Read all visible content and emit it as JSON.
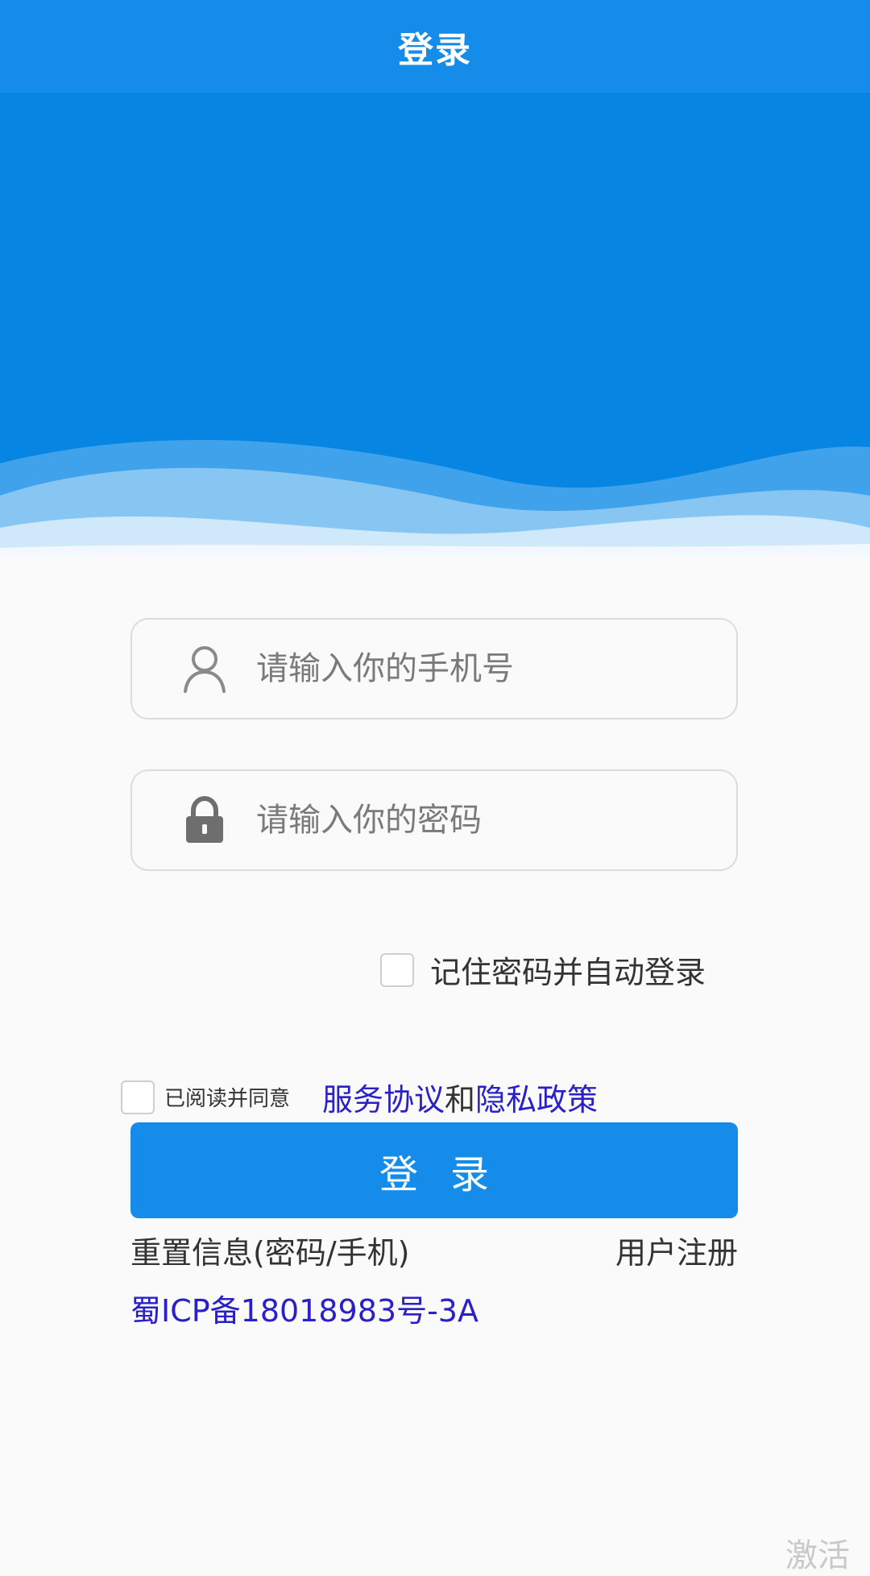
{
  "header": {
    "title": "登录"
  },
  "form": {
    "phone_placeholder": "请输入你的手机号",
    "password_placeholder": "请输入你的密码",
    "remember_label": "记住密码并自动登录",
    "agree_label": "已阅读并同意",
    "service_link": "服务协议",
    "and_text": "和",
    "privacy_link": "隐私政策",
    "login_button": "登录"
  },
  "links": {
    "reset": "重置信息(密码/手机)",
    "register": "用户注册",
    "icp": "蜀ICP备18018983号-3A"
  },
  "corner_text": "激活",
  "icons": {
    "phone_field": "user-icon",
    "password_field": "lock-icon"
  },
  "colors": {
    "primary": "#158cea",
    "banner": "#0686e2",
    "link": "#2a20c8",
    "background": "#fafafa"
  }
}
